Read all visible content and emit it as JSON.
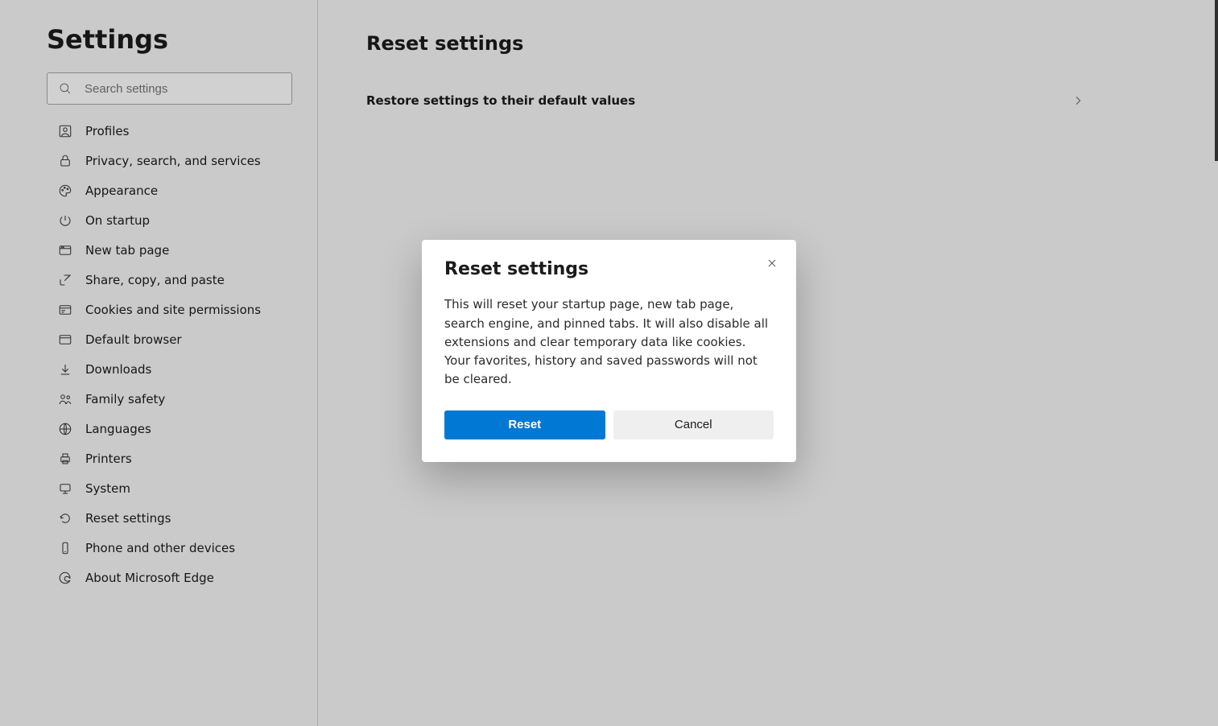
{
  "sidebar": {
    "title": "Settings",
    "search_placeholder": "Search settings",
    "items": [
      {
        "id": "profiles",
        "label": "Profiles"
      },
      {
        "id": "privacy",
        "label": "Privacy, search, and services"
      },
      {
        "id": "appearance",
        "label": "Appearance"
      },
      {
        "id": "startup",
        "label": "On startup"
      },
      {
        "id": "newtab",
        "label": "New tab page"
      },
      {
        "id": "share",
        "label": "Share, copy, and paste"
      },
      {
        "id": "cookies",
        "label": "Cookies and site permissions"
      },
      {
        "id": "default-browser",
        "label": "Default browser"
      },
      {
        "id": "downloads",
        "label": "Downloads"
      },
      {
        "id": "family",
        "label": "Family safety"
      },
      {
        "id": "languages",
        "label": "Languages"
      },
      {
        "id": "printers",
        "label": "Printers"
      },
      {
        "id": "system",
        "label": "System"
      },
      {
        "id": "reset",
        "label": "Reset settings"
      },
      {
        "id": "phone",
        "label": "Phone and other devices"
      },
      {
        "id": "about",
        "label": "About Microsoft Edge"
      }
    ]
  },
  "main": {
    "title": "Reset settings",
    "row_label": "Restore settings to their default values"
  },
  "dialog": {
    "title": "Reset settings",
    "body": "This will reset your startup page, new tab page, search engine, and pinned tabs. It will also disable all extensions and clear temporary data like cookies. Your favorites, history and saved passwords will not be cleared.",
    "primary": "Reset",
    "secondary": "Cancel"
  }
}
